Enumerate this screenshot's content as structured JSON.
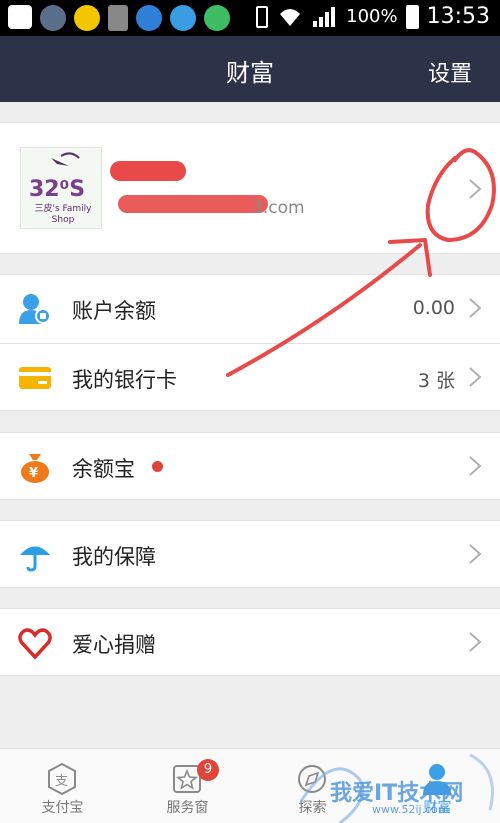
{
  "status_bar": {
    "battery": "100%",
    "time": "13:53"
  },
  "nav": {
    "title": "财富",
    "settings_label": "设置"
  },
  "profile": {
    "avatar_text": "三皮's Family Shop",
    "email_visible": "3.com"
  },
  "rows": {
    "balance": {
      "label": "账户余额",
      "value": "0.00"
    },
    "bank_card": {
      "label": "我的银行卡",
      "value": "3 张"
    },
    "yuebao": {
      "label": "余额宝"
    },
    "insurance": {
      "label": "我的保障"
    },
    "donation": {
      "label": "爱心捐赠"
    }
  },
  "tabs": [
    {
      "label": "支付宝",
      "icon": "alipay-icon"
    },
    {
      "label": "服务窗",
      "icon": "star-box-icon",
      "badge": "9"
    },
    {
      "label": "探索",
      "icon": "compass-icon"
    },
    {
      "label": "财富",
      "icon": "person-icon"
    }
  ],
  "watermark": {
    "text": "我爱IT技术网",
    "url": "www.52ij.com"
  },
  "colors": {
    "nav_bg": "#2c3247",
    "accent_blue": "#3aa0e8",
    "badge_red": "#e0453a",
    "annotation_red": "#e84a4a"
  }
}
